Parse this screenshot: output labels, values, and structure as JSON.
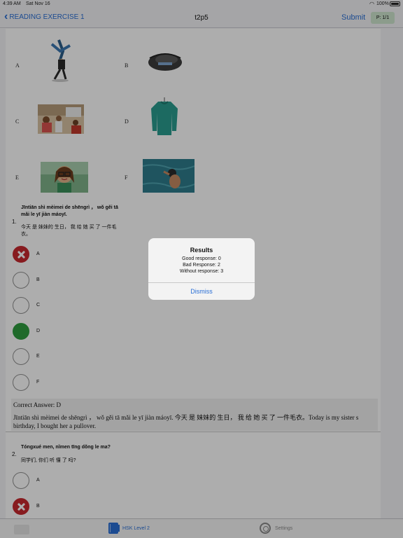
{
  "status_bar": {
    "time": "4:39 AM",
    "date": "Sat Nov 16",
    "battery": "100%"
  },
  "nav": {
    "back_label": "READING EXERCISE 1",
    "title": "t2p5",
    "submit_label": "Submit",
    "page_badge": "P: 1/1"
  },
  "image_options": [
    {
      "letter": "A",
      "icon": "breakdancer-image"
    },
    {
      "letter": "B",
      "icon": "backpack-image"
    },
    {
      "letter": "C",
      "icon": "classroom-image"
    },
    {
      "letter": "D",
      "icon": "sweater-image"
    },
    {
      "letter": "E",
      "icon": "girl-glasses-image"
    },
    {
      "letter": "F",
      "icon": "swimmer-image"
    }
  ],
  "question1": {
    "number": "1.",
    "pinyin": "Jīntiān shì mèimei de shēngrì ，  wǒ gěi tā mǎi le yī jiàn máoyī.",
    "hanzi": "今天 是 妹妹的 生日， 我 给 她 买 了 一件毛衣。",
    "choices": [
      {
        "label": "A",
        "state": "wrong"
      },
      {
        "label": "B",
        "state": "empty"
      },
      {
        "label": "C",
        "state": "empty"
      },
      {
        "label": "D",
        "state": "correct"
      },
      {
        "label": "E",
        "state": "empty"
      },
      {
        "label": "F",
        "state": "empty"
      }
    ],
    "correct_answer": "Correct Answer: D",
    "explanation": "Jīntiān shì mèimei de shēngrì ，  wǒ gěi tā mǎi le yī jiàn máoyī.  今天 是 妹妹的 生日， 我 给 她 买 了 一件毛衣。Today is my sister s birthday, I bought her a pullover."
  },
  "question2": {
    "number": "2.",
    "pinyin": "Tóngxué men, nǐmen tīng dǒng le ma?",
    "hanzi": "同学们, 你们 听 懂 了 吗?",
    "choices": [
      {
        "label": "A",
        "state": "empty"
      },
      {
        "label": "B",
        "state": "wrong"
      }
    ]
  },
  "alert": {
    "title": "Results",
    "good": "Good response: 0",
    "bad": "Bad Response: 2",
    "without": "Without response: 3",
    "dismiss": "Dismiss"
  },
  "tabbar": {
    "hsk_label": "HSK Level 2",
    "settings_label": "Settings"
  },
  "colors": {
    "accent": "#2a6fd6",
    "wrong": "#c8282f",
    "correct": "#2e9d3f",
    "badge": "#cfe6cf"
  }
}
